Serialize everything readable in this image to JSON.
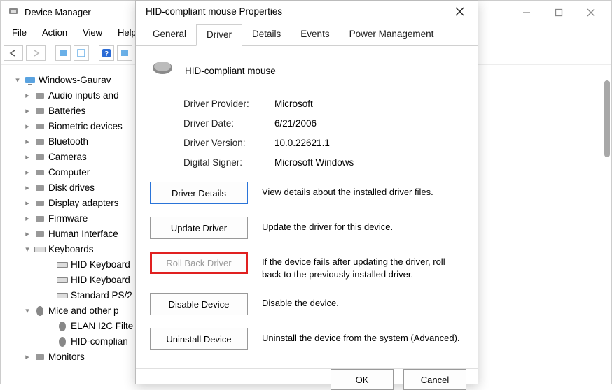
{
  "main": {
    "title": "Device Manager",
    "menus": [
      "File",
      "Action",
      "View",
      "Help"
    ]
  },
  "tree": {
    "root": "Windows-Gaurav",
    "items": [
      {
        "label": "Audio inputs and",
        "expanded": false,
        "depth": 1
      },
      {
        "label": "Batteries",
        "expanded": false,
        "depth": 1
      },
      {
        "label": "Biometric devices",
        "expanded": false,
        "depth": 1
      },
      {
        "label": "Bluetooth",
        "expanded": false,
        "depth": 1
      },
      {
        "label": "Cameras",
        "expanded": false,
        "depth": 1
      },
      {
        "label": "Computer",
        "expanded": false,
        "depth": 1
      },
      {
        "label": "Disk drives",
        "expanded": false,
        "depth": 1
      },
      {
        "label": "Display adapters",
        "expanded": false,
        "depth": 1
      },
      {
        "label": "Firmware",
        "expanded": false,
        "depth": 1
      },
      {
        "label": "Human Interface",
        "expanded": false,
        "depth": 1
      },
      {
        "label": "Keyboards",
        "expanded": true,
        "depth": 1
      },
      {
        "label": "HID Keyboard",
        "expanded": null,
        "depth": 2
      },
      {
        "label": "HID Keyboard",
        "expanded": null,
        "depth": 2
      },
      {
        "label": "Standard PS/2",
        "expanded": null,
        "depth": 2
      },
      {
        "label": "Mice and other p",
        "expanded": true,
        "depth": 1
      },
      {
        "label": "ELAN I2C Filte",
        "expanded": null,
        "depth": 2
      },
      {
        "label": "HID-complian",
        "expanded": null,
        "depth": 2
      },
      {
        "label": "Monitors",
        "expanded": false,
        "depth": 1
      }
    ]
  },
  "dialog": {
    "title": "HID-compliant mouse Properties",
    "tabs": [
      "General",
      "Driver",
      "Details",
      "Events",
      "Power Management"
    ],
    "active_tab": 1,
    "device_name": "HID-compliant mouse",
    "info": [
      {
        "k": "Driver Provider:",
        "v": "Microsoft"
      },
      {
        "k": "Driver Date:",
        "v": "6/21/2006"
      },
      {
        "k": "Driver Version:",
        "v": "10.0.22621.1"
      },
      {
        "k": "Digital Signer:",
        "v": "Microsoft Windows"
      }
    ],
    "actions": [
      {
        "label": "Driver Details",
        "desc": "View details about the installed driver files.",
        "state": "primary"
      },
      {
        "label": "Update Driver",
        "desc": "Update the driver for this device.",
        "state": "normal"
      },
      {
        "label": "Roll Back Driver",
        "desc": "If the device fails after updating the driver, roll back to the previously installed driver.",
        "state": "disabled",
        "highlight": true
      },
      {
        "label": "Disable Device",
        "desc": "Disable the device.",
        "state": "normal"
      },
      {
        "label": "Uninstall Device",
        "desc": "Uninstall the device from the system (Advanced).",
        "state": "normal"
      }
    ],
    "footer": {
      "ok": "OK",
      "cancel": "Cancel"
    }
  }
}
